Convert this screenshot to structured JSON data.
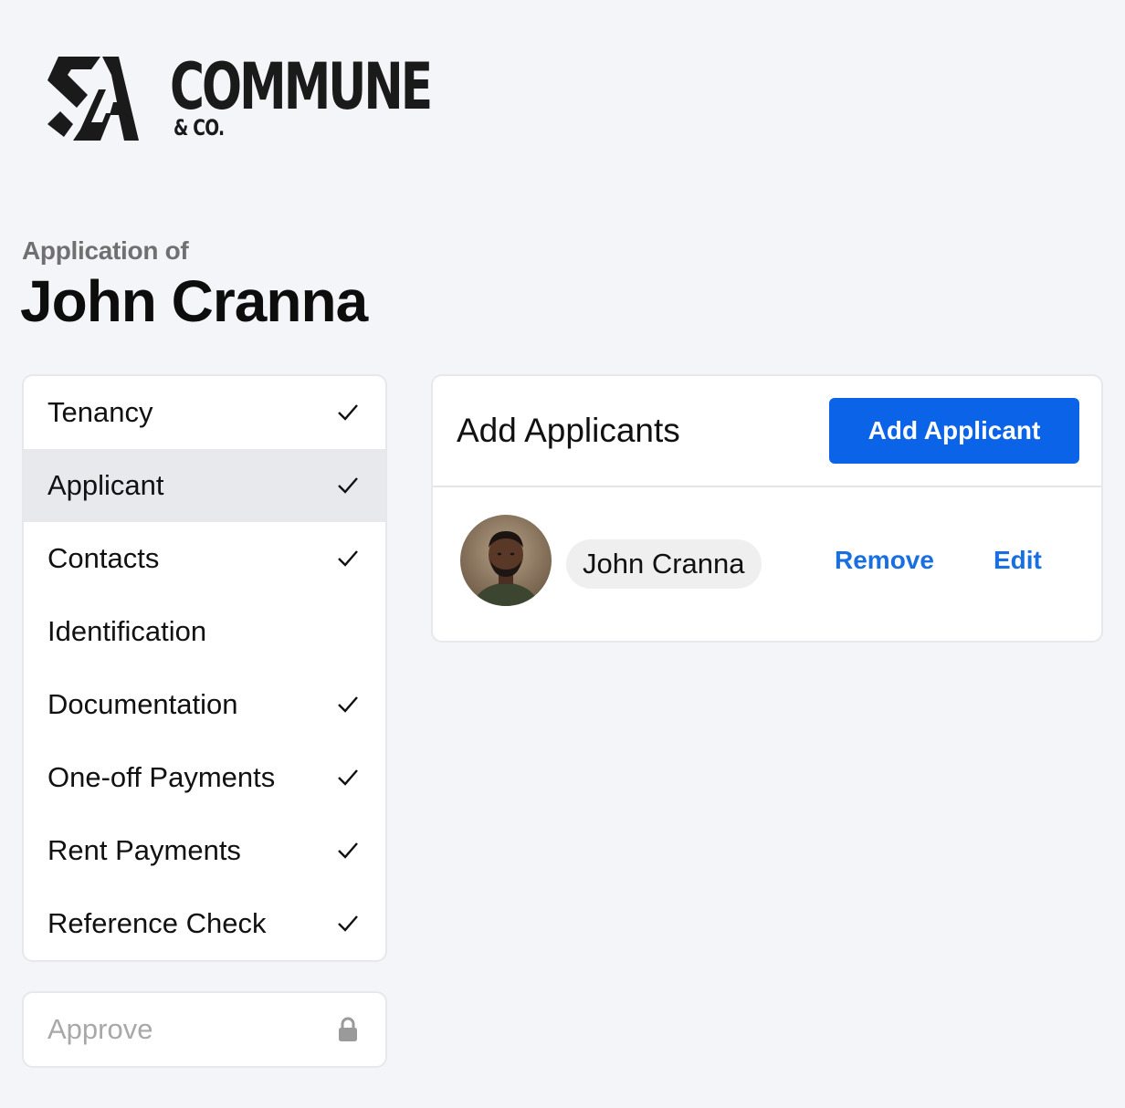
{
  "brand": {
    "name": "COMMUNE",
    "sub": "& CO.",
    "logo_icon": "sa-monogram-icon"
  },
  "header": {
    "subtitle": "Application of",
    "applicant_name": "John Cranna"
  },
  "steps": [
    {
      "label": "Tenancy",
      "complete": true,
      "active": false
    },
    {
      "label": "Applicant",
      "complete": true,
      "active": true
    },
    {
      "label": "Contacts",
      "complete": true,
      "active": false
    },
    {
      "label": "Identification",
      "complete": false,
      "active": false
    },
    {
      "label": "Documentation",
      "complete": true,
      "active": false
    },
    {
      "label": "One-off Payments",
      "complete": true,
      "active": false
    },
    {
      "label": "Rent Payments",
      "complete": true,
      "active": false
    },
    {
      "label": "Reference Check",
      "complete": true,
      "active": false
    }
  ],
  "approve": {
    "label": "Approve",
    "locked": true
  },
  "panel": {
    "title": "Add Applicants",
    "add_button": "Add Applicant",
    "applicants": [
      {
        "name": "John Cranna",
        "remove_label": "Remove",
        "edit_label": "Edit"
      }
    ]
  },
  "colors": {
    "accent": "#0b63e8",
    "link": "#1a6fe0",
    "background": "#f3f5f8",
    "active_step": "#e8e9ec"
  }
}
